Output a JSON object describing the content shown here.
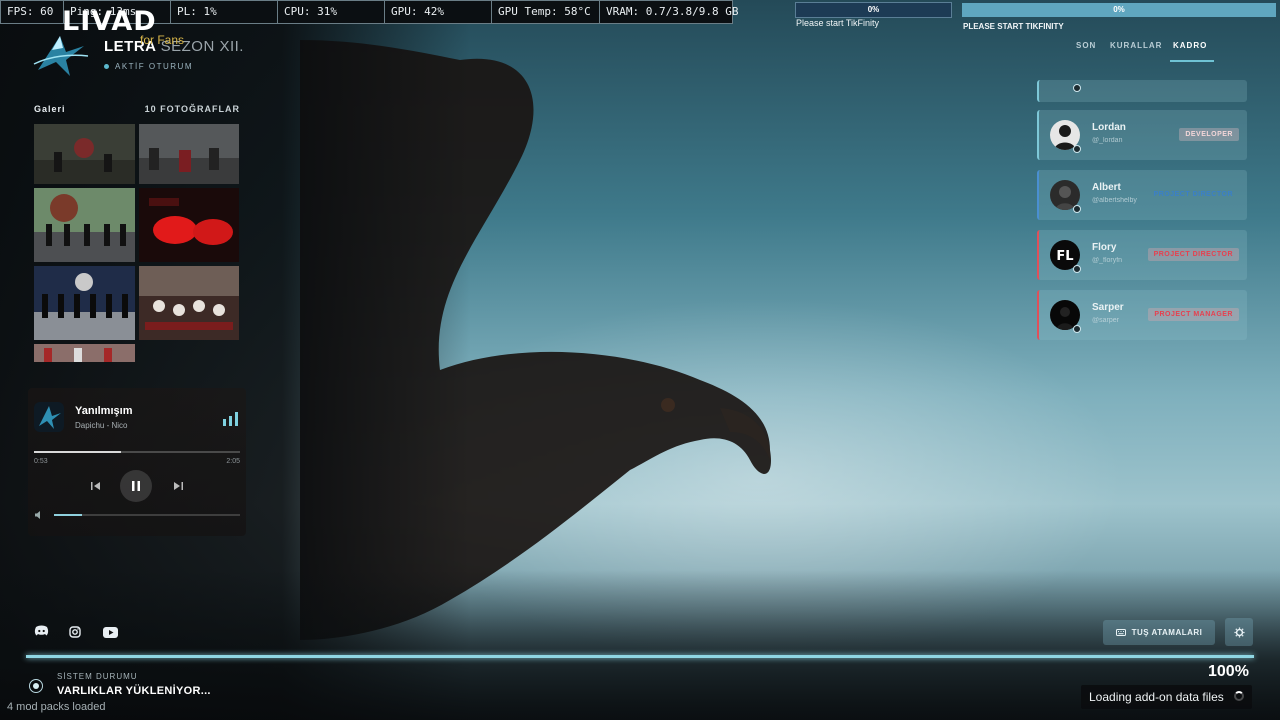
{
  "perf": {
    "fps": "FPS: 60",
    "ping": "Ping: 13ms",
    "pl": "PL: 1%",
    "cpu": "CPU: 31%",
    "gpu": "GPU: 42%",
    "gpu_temp": "GPU Temp: 58°C",
    "vram": "VRAM: 0.7/3.8/9.8 GB"
  },
  "brand": {
    "name": "LIVAD",
    "sub": "for Fans"
  },
  "header": {
    "title_main": "LETRA",
    "title_season": "SEZON XII.",
    "status": "AKTİF OTURUM"
  },
  "gallery": {
    "title": "Galeri",
    "count": "10 FOTOĞRAFLAR"
  },
  "player": {
    "song": "Yanılmışım",
    "artist": "Dapichu - Nico",
    "current_time": "0:53",
    "total_time": "2:05",
    "progress_fraction": 0.42,
    "volume_fraction": 0.15
  },
  "tikfinity": {
    "left_percent": "0%",
    "left_message": "Please start TikFinity",
    "right_percent": "0%",
    "right_message": "PLEASE START TIKFINITY"
  },
  "nav": {
    "items": [
      {
        "label": "SON"
      },
      {
        "label": "KURALLAR"
      },
      {
        "label": "KADRO"
      }
    ],
    "active": "KADRO"
  },
  "team": [
    {
      "name": "Lordan",
      "handle": "@_lordan",
      "role": "DEVELOPER"
    },
    {
      "name": "Albert",
      "handle": "@albertshelby",
      "role": "PROJECT DIRECTOR"
    },
    {
      "name": "Flory",
      "handle": "@_floryfn",
      "role": "PROJECT DIRECTOR"
    },
    {
      "name": "Sarper",
      "handle": "@sarper",
      "role": "PROJECT MANAGER"
    }
  ],
  "controls": {
    "keybinds_label": "TUŞ ATAMALARI"
  },
  "loading": {
    "percent": "100%",
    "fraction": 1.0,
    "system_label": "SİSTEM DURUMU",
    "system_value": "VARLIKLAR YÜKLENİYOR...",
    "mods": "4 mod packs loaded",
    "toast": "Loading add-on data files"
  },
  "colors": {
    "accent": "#8fd6e3",
    "red_role": "#e6404f",
    "blue_role": "#3a7fc8"
  },
  "icons": {
    "social": [
      "discord-icon",
      "instagram-icon",
      "youtube-icon"
    ]
  }
}
